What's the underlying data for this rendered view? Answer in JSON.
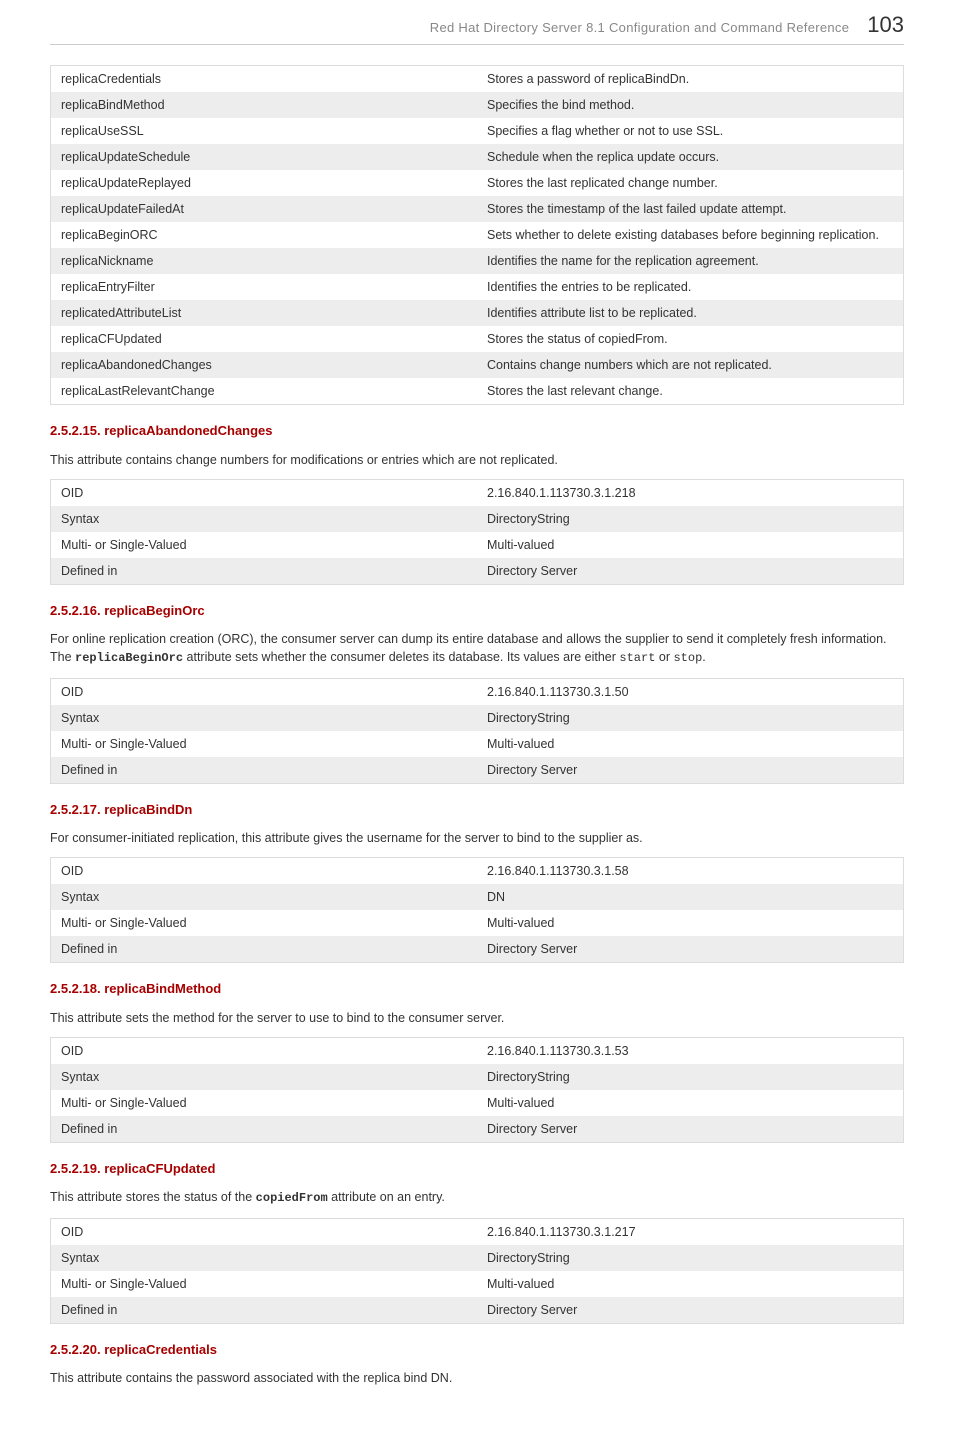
{
  "header": {
    "title": "Red Hat Directory Server 8.1 Configuration and Command Reference",
    "page_number": "103"
  },
  "top_table": [
    {
      "attr": "replicaCredentials",
      "desc": "Stores a password of replicaBindDn."
    },
    {
      "attr": "replicaBindMethod",
      "desc": "Specifies the bind method."
    },
    {
      "attr": "replicaUseSSL",
      "desc": "Specifies a flag whether or not to use SSL."
    },
    {
      "attr": "replicaUpdateSchedule",
      "desc": "Schedule when the replica update occurs."
    },
    {
      "attr": "replicaUpdateReplayed",
      "desc": "Stores the last replicated change number."
    },
    {
      "attr": "replicaUpdateFailedAt",
      "desc": "Stores the timestamp of the last failed update attempt."
    },
    {
      "attr": "replicaBeginORC",
      "desc": "Sets whether to delete existing databases before beginning replication."
    },
    {
      "attr": "replicaNickname",
      "desc": "Identifies the name for the replication agreement."
    },
    {
      "attr": "replicaEntryFilter",
      "desc": "Identifies the entries to be replicated."
    },
    {
      "attr": "replicatedAttributeList",
      "desc": "Identifies attribute list to be replicated."
    },
    {
      "attr": "replicaCFUpdated",
      "desc": "Stores the status of copiedFrom."
    },
    {
      "attr": "replicaAbandonedChanges",
      "desc": "Contains change numbers which are not replicated."
    },
    {
      "attr": "replicaLastRelevantChange",
      "desc": "Stores the last relevant change."
    }
  ],
  "sections": {
    "s15": {
      "heading": "2.5.2.15. replicaAbandonedChanges",
      "text": "This attribute contains change numbers for modifications or entries which are not replicated.",
      "rows": [
        {
          "k": "OID",
          "v": "2.16.840.1.113730.3.1.218"
        },
        {
          "k": "Syntax",
          "v": "DirectoryString"
        },
        {
          "k": "Multi- or Single-Valued",
          "v": "Multi-valued"
        },
        {
          "k": "Defined in",
          "v": "Directory Server"
        }
      ]
    },
    "s16": {
      "heading": "2.5.2.16. replicaBeginOrc",
      "text_pre": "For online replication creation (ORC), the consumer server can dump its entire database and allows the supplier to send it completely fresh information. The ",
      "code1": "replicaBeginOrc",
      "text_mid": " attribute sets whether the consumer deletes its database. Its values are either ",
      "code2": "start",
      "text_or": " or ",
      "code3": "stop",
      "text_end": ".",
      "rows": [
        {
          "k": "OID",
          "v": "2.16.840.1.113730.3.1.50"
        },
        {
          "k": "Syntax",
          "v": "DirectoryString"
        },
        {
          "k": "Multi- or Single-Valued",
          "v": "Multi-valued"
        },
        {
          "k": "Defined in",
          "v": "Directory Server"
        }
      ]
    },
    "s17": {
      "heading": "2.5.2.17. replicaBindDn",
      "text": "For consumer-initiated replication, this attribute gives the username for the server to bind to the supplier as.",
      "rows": [
        {
          "k": "OID",
          "v": "2.16.840.1.113730.3.1.58"
        },
        {
          "k": "Syntax",
          "v": "DN"
        },
        {
          "k": "Multi- or Single-Valued",
          "v": "Multi-valued"
        },
        {
          "k": "Defined in",
          "v": "Directory Server"
        }
      ]
    },
    "s18": {
      "heading": "2.5.2.18. replicaBindMethod",
      "text": "This attribute sets the method for the server to use to bind to the consumer server.",
      "rows": [
        {
          "k": "OID",
          "v": "2.16.840.1.113730.3.1.53"
        },
        {
          "k": "Syntax",
          "v": "DirectoryString"
        },
        {
          "k": "Multi- or Single-Valued",
          "v": "Multi-valued"
        },
        {
          "k": "Defined in",
          "v": "Directory Server"
        }
      ]
    },
    "s19": {
      "heading": "2.5.2.19. replicaCFUpdated",
      "text_pre": "This attribute stores the status of the ",
      "code1": "copiedFrom",
      "text_end": " attribute on an entry.",
      "rows": [
        {
          "k": "OID",
          "v": "2.16.840.1.113730.3.1.217"
        },
        {
          "k": "Syntax",
          "v": "DirectoryString"
        },
        {
          "k": "Multi- or Single-Valued",
          "v": "Multi-valued"
        },
        {
          "k": "Defined in",
          "v": "Directory Server"
        }
      ]
    },
    "s20": {
      "heading": "2.5.2.20. replicaCredentials",
      "text": "This attribute contains the password associated with the replica bind DN."
    }
  }
}
